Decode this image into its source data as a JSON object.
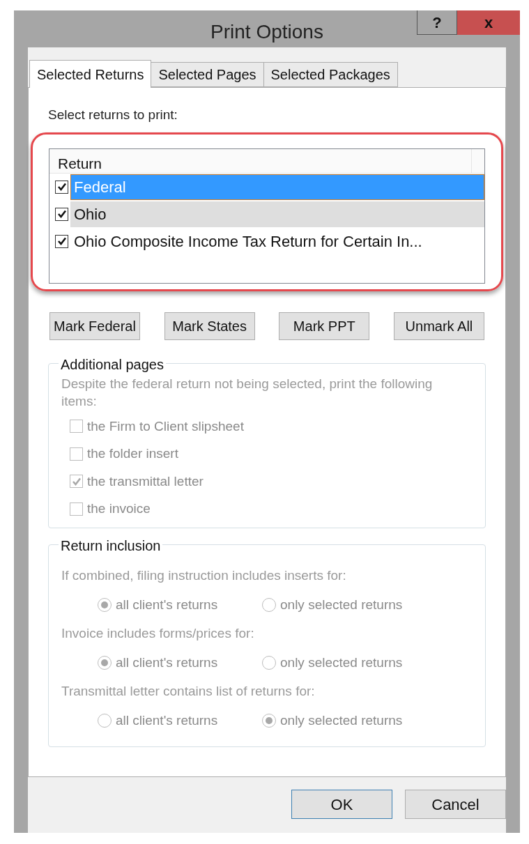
{
  "window": {
    "title": "Print Options",
    "help": "?",
    "close": "x"
  },
  "tabs": [
    {
      "label": "Selected Returns",
      "selected": true
    },
    {
      "label": "Selected Pages",
      "selected": false
    },
    {
      "label": "Selected Packages",
      "selected": false
    }
  ],
  "prompt": "Select returns to print:",
  "returns_list": {
    "column": "Return",
    "rows": [
      {
        "label": "Federal",
        "checked": true,
        "selected": true,
        "highlighted": false
      },
      {
        "label": "Ohio",
        "checked": true,
        "selected": false,
        "highlighted": true
      },
      {
        "label": "Ohio Composite Income Tax Return for Certain In...",
        "checked": true,
        "selected": false,
        "highlighted": false
      }
    ]
  },
  "mark_buttons": [
    "Mark Federal",
    "Mark States",
    "Mark PPT",
    "Unmark All"
  ],
  "additional_pages": {
    "title": "Additional pages",
    "description": "Despite the federal return not being selected, print the following items:",
    "items": [
      {
        "label": "the Firm to Client slipsheet",
        "checked": false
      },
      {
        "label": "the folder insert",
        "checked": false
      },
      {
        "label": "the transmittal letter",
        "checked": true
      },
      {
        "label": "the invoice",
        "checked": false
      }
    ]
  },
  "return_inclusion": {
    "title": "Return inclusion",
    "questions": [
      {
        "label": "If combined, filing instruction includes inserts for:",
        "options": [
          {
            "label": "all client's returns",
            "selected": true
          },
          {
            "label": "only selected returns",
            "selected": false
          }
        ]
      },
      {
        "label": "Invoice includes forms/prices for:",
        "options": [
          {
            "label": "all client's returns",
            "selected": true
          },
          {
            "label": "only selected returns",
            "selected": false
          }
        ]
      },
      {
        "label": "Transmittal letter contains list of returns for:",
        "options": [
          {
            "label": "all client's returns",
            "selected": false
          },
          {
            "label": "only selected returns",
            "selected": true
          }
        ]
      }
    ]
  },
  "buttons": [
    {
      "label": "OK",
      "default": true
    },
    {
      "label": "Cancel",
      "default": false
    }
  ]
}
